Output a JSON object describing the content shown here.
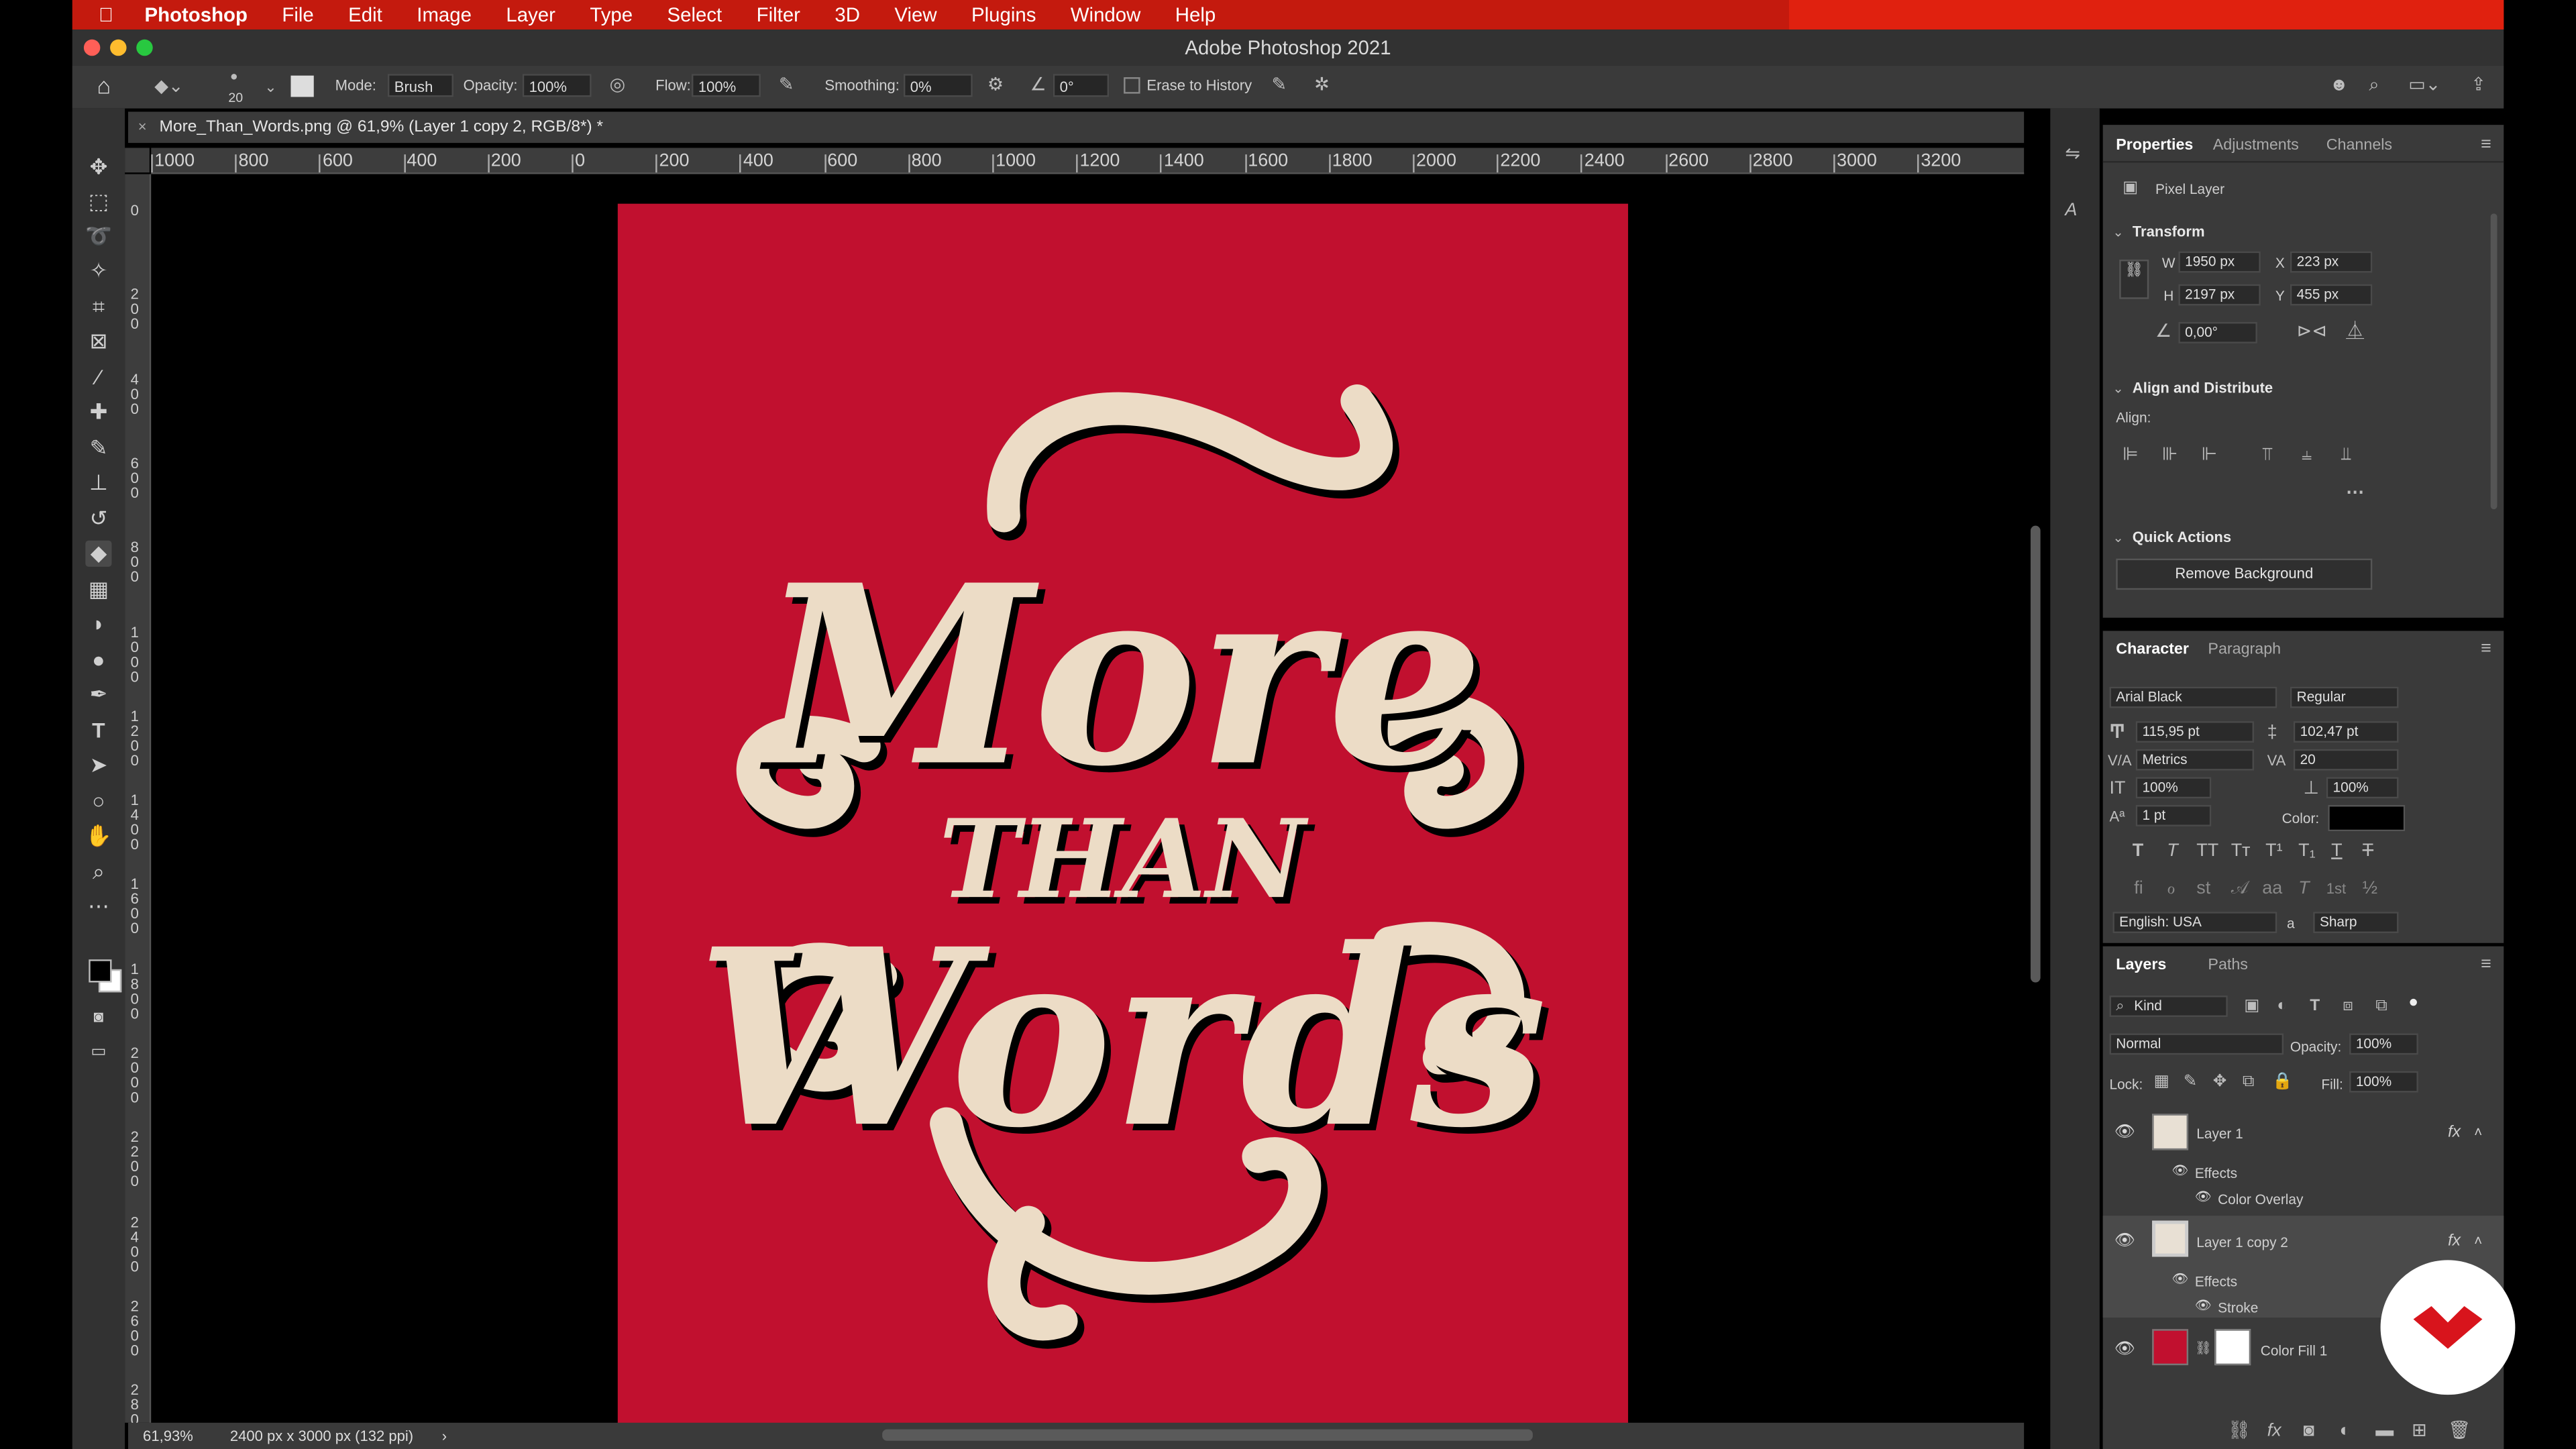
{
  "menubar": {
    "apple": "",
    "app_name": "Photoshop",
    "items": [
      "File",
      "Edit",
      "Image",
      "Layer",
      "Type",
      "Select",
      "Filter",
      "3D",
      "View",
      "Plugins",
      "Window",
      "Help"
    ]
  },
  "window": {
    "title": "Adobe Photoshop 2021"
  },
  "options": {
    "brush_size": "20",
    "mode_label": "Mode:",
    "mode_value": "Brush",
    "opacity_label": "Opacity:",
    "opacity_value": "100%",
    "flow_label": "Flow:",
    "flow_value": "100%",
    "smoothing_label": "Smoothing:",
    "smoothing_value": "0%",
    "angle_value": "0°",
    "erase_history_label": "Erase to History"
  },
  "document": {
    "tab_title": "More_Than_Words.png @ 61,9% (Layer 1 copy 2, RGB/8*) *",
    "zoom": "61,93%",
    "info": "2400 px x 3000 px (132 ppi)"
  },
  "ruler": {
    "h_labels": [
      "1000",
      "800",
      "600",
      "400",
      "200",
      "0",
      "200",
      "400",
      "600",
      "800",
      "1000",
      "1200",
      "1400",
      "1600",
      "1800",
      "2000",
      "2200",
      "2400",
      "2600",
      "2800",
      "3000",
      "3200"
    ],
    "v_labels": [
      "0",
      "2\n0\n0",
      "4\n0\n0",
      "6\n0\n0",
      "8\n0\n0",
      "1\n0\n0\n0",
      "1\n2\n0\n0",
      "1\n4\n0\n0",
      "1\n6\n0\n0",
      "1\n8\n0\n0",
      "2\n0\n0\n0",
      "2\n2\n0\n0",
      "2\n4\n0\n0",
      "2\n6\n0\n0",
      "2\n8\n0\n0"
    ]
  },
  "artwork": {
    "line1": "More",
    "line2": "THAN",
    "line3": "Words",
    "bg": "#c1102f",
    "fg": "#ecdcc6"
  },
  "properties": {
    "tabs": [
      "Properties",
      "Adjustments",
      "Channels"
    ],
    "kind": "Pixel Layer",
    "transform_label": "Transform",
    "w_label": "W",
    "w_value": "1950 px",
    "x_label": "X",
    "x_value": "223 px",
    "h_label": "H",
    "h_value": "2197 px",
    "y_label": "Y",
    "y_value": "455 px",
    "angle_value": "0,00°",
    "align_label": "Align and Distribute",
    "align_sub": "Align:",
    "quick_label": "Quick Actions",
    "remove_bg": "Remove Background"
  },
  "character": {
    "tabs": [
      "Character",
      "Paragraph"
    ],
    "font": "Arial Black",
    "style": "Regular",
    "size": "115,95 pt",
    "leading": "102,47 pt",
    "kerning": "Metrics",
    "tracking": "20",
    "vscale": "100%",
    "hscale": "100%",
    "baseline": "1 pt",
    "color_label": "Color:",
    "language": "English: USA",
    "aa_label": "a",
    "antialias": "Sharp",
    "style_buttons": [
      "T",
      "T",
      "TT",
      "Tт",
      "T¹",
      "T₁",
      "T",
      "T"
    ],
    "ot_buttons": [
      "ﬁ",
      "ℴ",
      "st",
      "𝒜",
      "aa",
      "T",
      "1st",
      "½"
    ]
  },
  "layers": {
    "tabs": [
      "Layers",
      "Paths"
    ],
    "filter": "Kind",
    "blend": "Normal",
    "opacity_label": "Opacity:",
    "opacity": "100%",
    "lock_label": "Lock:",
    "fill_label": "Fill:",
    "fill": "100%",
    "items": [
      {
        "name": "Layer 1",
        "effects": "Effects",
        "effect": "Color Overlay"
      },
      {
        "name": "Layer 1 copy 2",
        "effects": "Effects",
        "effect": "Stroke"
      },
      {
        "name": "Color Fill 1"
      }
    ],
    "fx": "fx"
  }
}
